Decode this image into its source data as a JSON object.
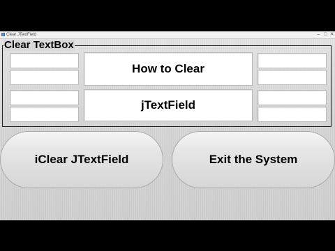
{
  "window": {
    "title": "Clear JTextField",
    "min_glyph": "–",
    "max_glyph": "□",
    "close_glyph": "✕"
  },
  "group": {
    "title": "Clear TextBox"
  },
  "fields": {
    "center_top": "How to Clear",
    "center_bottom": "jTextField"
  },
  "buttons": {
    "clear_label": "iClear JTextField",
    "exit_label": "Exit the System"
  },
  "icons": {
    "app": "java-app-icon"
  }
}
